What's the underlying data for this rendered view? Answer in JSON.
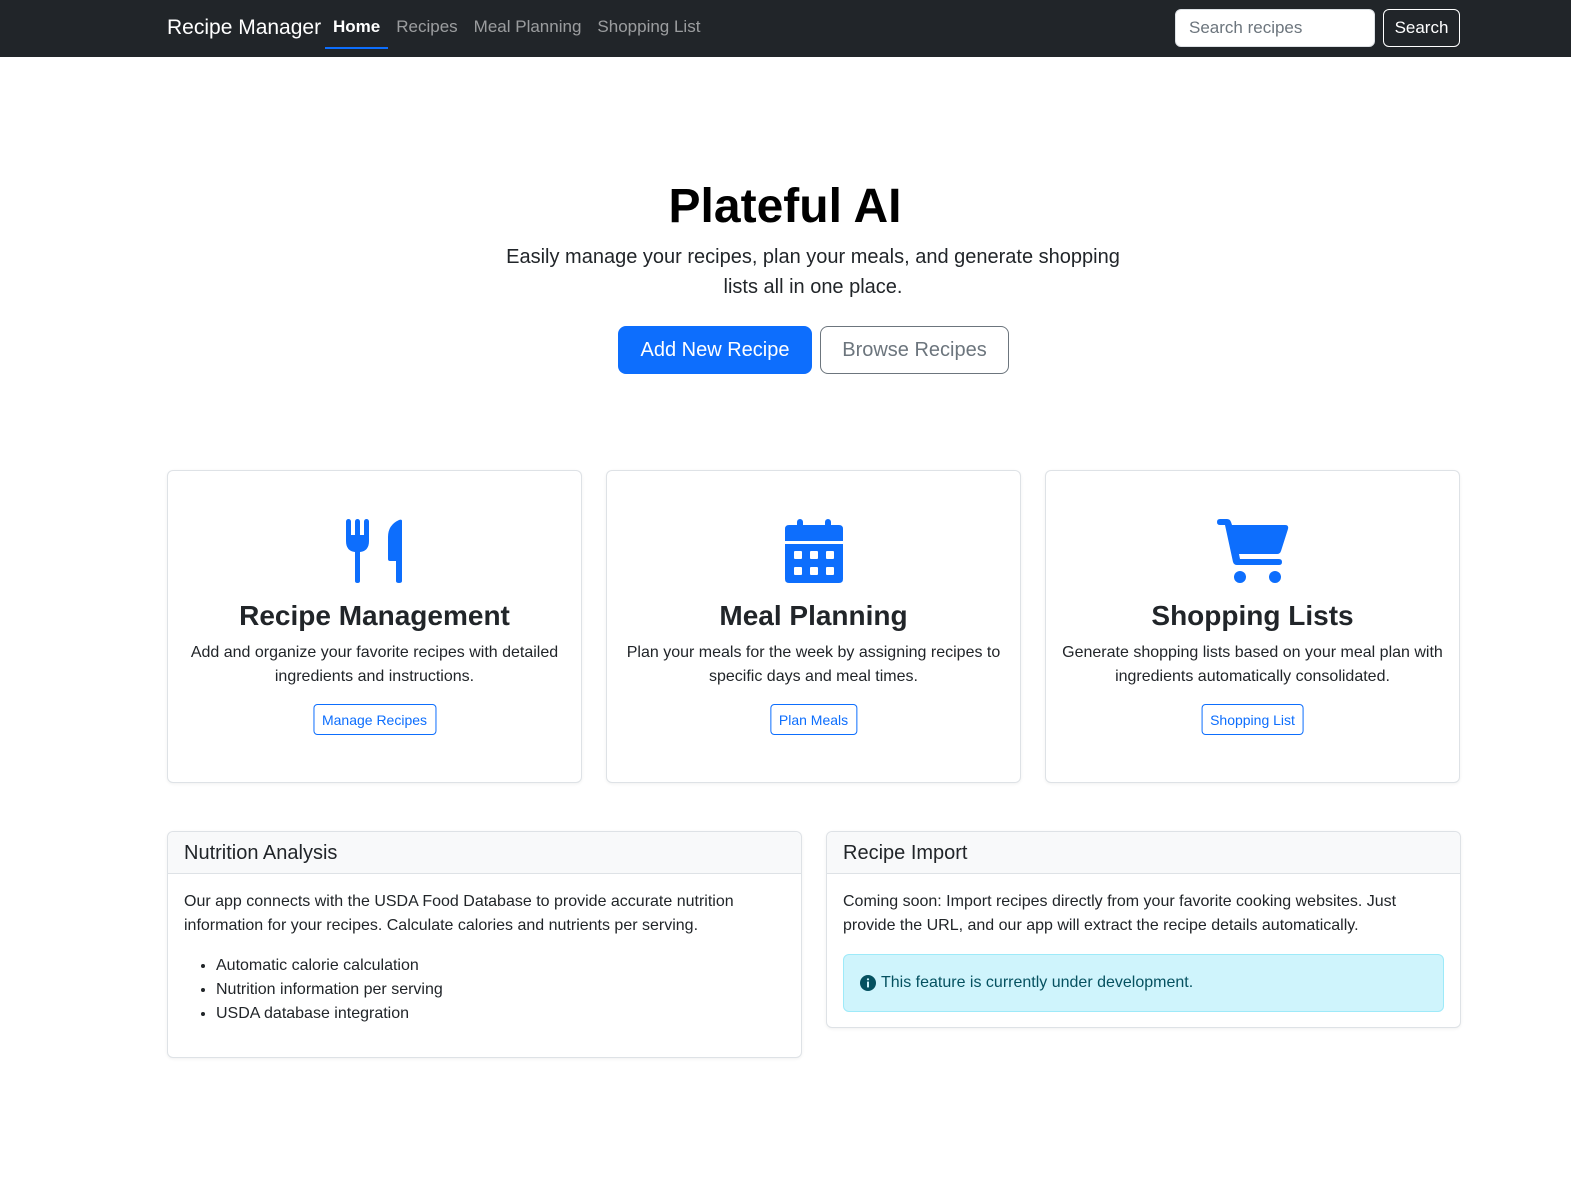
{
  "navbar": {
    "brand": "Recipe Manager",
    "links": [
      {
        "label": "Home",
        "active": true
      },
      {
        "label": "Recipes",
        "active": false
      },
      {
        "label": "Meal Planning",
        "active": false
      },
      {
        "label": "Shopping List",
        "active": false
      }
    ],
    "search_placeholder": "Search recipes",
    "search_button": "Search"
  },
  "hero": {
    "title": "Plateful AI",
    "lead": "Easily manage your recipes, plan your meals, and generate shopping lists all in one place.",
    "primary_button": "Add New Recipe",
    "secondary_button": "Browse Recipes"
  },
  "features": [
    {
      "icon": "fork-knife-icon",
      "title": "Recipe Management",
      "text": "Add and organize your favorite recipes with detailed ingredients and instructions.",
      "button": "Manage Recipes"
    },
    {
      "icon": "calendar-icon",
      "title": "Meal Planning",
      "text": "Plan your meals for the week by assigning recipes to specific days and meal times.",
      "button": "Plan Meals"
    },
    {
      "icon": "cart-icon",
      "title": "Shopping Lists",
      "text": "Generate shopping lists based on your meal plan with ingredients automatically consolidated.",
      "button": "Shopping List"
    }
  ],
  "nutrition": {
    "header": "Nutrition Analysis",
    "text": "Our app connects with the USDA Food Database to provide accurate nutrition information for your recipes. Calculate calories and nutrients per serving.",
    "items": [
      "Automatic calorie calculation",
      "Nutrition information per serving",
      "USDA database integration"
    ]
  },
  "import": {
    "header": "Recipe Import",
    "text": "Coming soon: Import recipes directly from your favorite cooking websites. Just provide the URL, and our app will extract the recipe details automatically.",
    "alert": "This feature is currently under development."
  },
  "colors": {
    "primary": "#0d6efd",
    "navbar": "#212529",
    "alert_bg": "#cff4fc",
    "alert_text": "#055160"
  }
}
